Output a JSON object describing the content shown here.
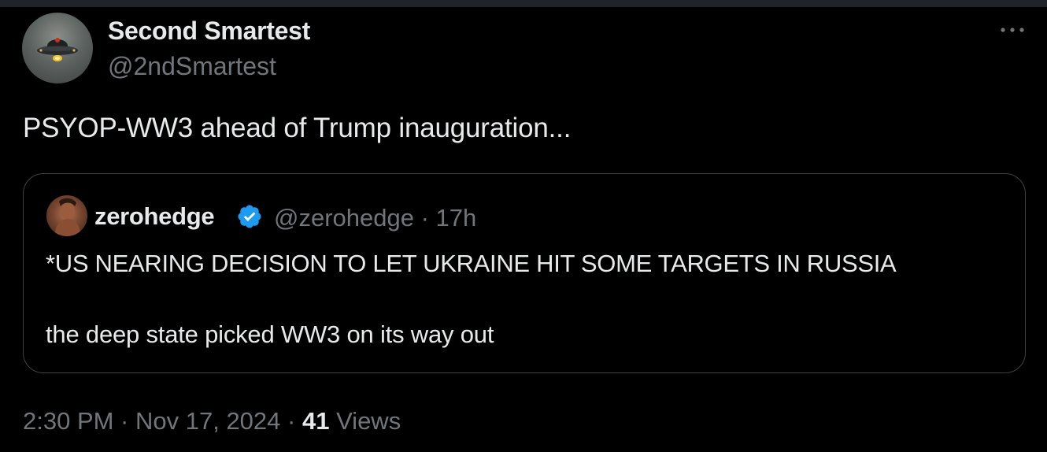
{
  "author": {
    "display_name": "Second Smartest",
    "handle": "@2ndSmartest",
    "avatar_icon": "ufo-avatar"
  },
  "tweet": {
    "text": "PSYOP-WW3 ahead of Trump inauguration..."
  },
  "more_icon": "more-horizontal-icon",
  "quote": {
    "name": "zerohedge",
    "verified_icon": "verified-badge-icon",
    "handle_time": "@zerohedge · 17h",
    "line1": "*US NEARING DECISION TO LET UKRAINE HIT SOME TARGETS IN RUSSIA",
    "line2": "the deep state picked WW3 on its way out"
  },
  "meta": {
    "timestamp": "2:30 PM · Nov 17, 2024 · ",
    "views_count": "41",
    "views_label": " Views"
  },
  "colors": {
    "background": "#000000",
    "text_primary": "#e7e9ea",
    "text_secondary": "#71767b",
    "verified": "#1d9bf0",
    "border": "#3e4144"
  }
}
